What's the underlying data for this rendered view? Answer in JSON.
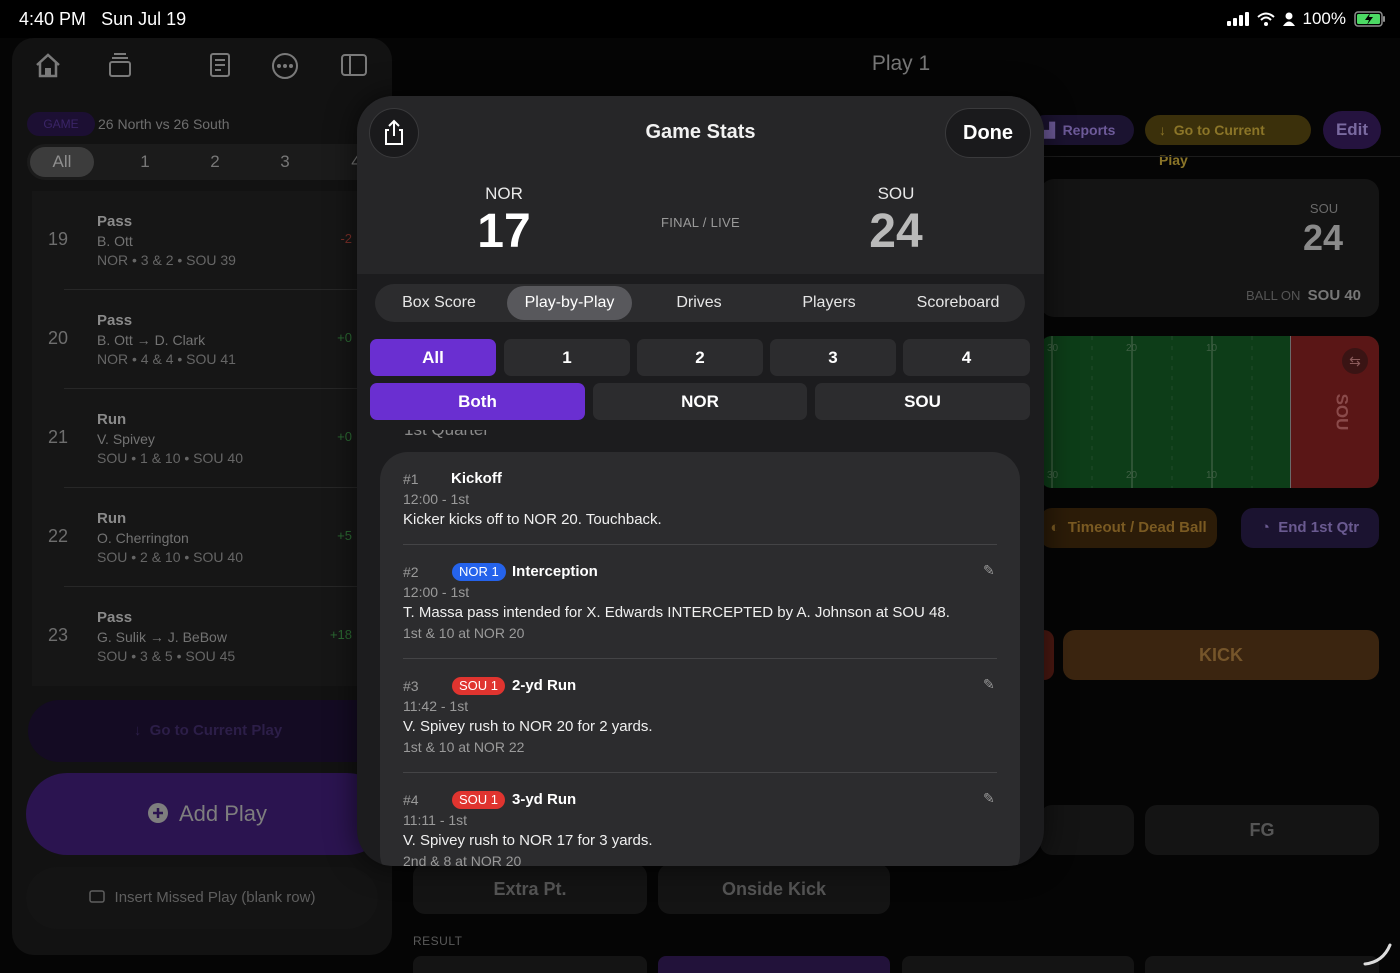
{
  "status_bar": {
    "time": "4:40 PM",
    "date": "Sun Jul 19",
    "battery": "100%"
  },
  "left_panel": {
    "game_badge": "GAME",
    "game_title": "26 North vs 26 South",
    "quarter_filters": [
      "All",
      "1",
      "2",
      "3",
      "4"
    ],
    "plays": [
      {
        "num": "19",
        "type": "Pass",
        "players": "B. Ott",
        "situation": "NOR • 3 & 2 • SOU 39",
        "yards": "-2",
        "yards_color": "#7a2f28"
      },
      {
        "num": "20",
        "type": "Pass",
        "players": "B. Ott → D. Clark",
        "situation": "NOR • 4 & 4 • SOU 41",
        "yards": "+0",
        "yards_color": "#2b6a32"
      },
      {
        "num": "21",
        "type": "Run",
        "players": "V. Spivey",
        "situation": "SOU • 1 & 10 • SOU 40",
        "yards": "+0",
        "yards_color": "#2b6a32"
      },
      {
        "num": "22",
        "type": "Run",
        "players": "O. Cherrington",
        "situation": "SOU • 2 & 10 • SOU 40",
        "yards": "+5",
        "yards_color": "#2b6a32"
      },
      {
        "num": "23",
        "type": "Pass",
        "players": "G. Sulik → J. BeBow",
        "situation": "SOU • 3 & 5 • SOU 45",
        "yards": "+18",
        "yards_color": "#2b6a32"
      }
    ],
    "go_current_play": "Go to Current Play",
    "add_play": "Add Play",
    "insert_missed": "Insert Missed Play (blank row)"
  },
  "right_bg": {
    "title": "Play 1",
    "reports": "Reports",
    "go_current_play": "Go to Current Play",
    "edit": "Edit",
    "team": "SOU",
    "score": "24",
    "ball_on_label": "BALL ON",
    "ball_on_value": "SOU 40",
    "field_end_label": "SOU",
    "yard_top": [
      "30",
      "20",
      "10"
    ],
    "yard_bottom": [
      "30",
      "20",
      "10"
    ],
    "timeout": "Timeout / Dead Ball",
    "end_qtr": "End 1st Qtr",
    "kick": "KICK",
    "fg": "FG",
    "extra_pt": "Extra Pt.",
    "onside_kick": "Onside Kick",
    "result_label": "RESULT"
  },
  "modal": {
    "title": "Game Stats",
    "done": "Done",
    "home_team": "NOR",
    "home_score": "17",
    "away_team": "SOU",
    "away_score": "24",
    "status": "FINAL / LIVE",
    "tabs": [
      "Box Score",
      "Play-by-Play",
      "Drives",
      "Players",
      "Scoreboard"
    ],
    "selected_tab": "Play-by-Play",
    "quarter_filters": [
      "All",
      "1",
      "2",
      "3",
      "4"
    ],
    "team_filters": [
      "Both",
      "NOR",
      "SOU"
    ],
    "section_header": "1st Quarter",
    "entries": [
      {
        "num": "#1",
        "title": "Kickoff",
        "time": "12:00 - 1st",
        "text": "Kicker kicks off to NOR 20. Touchback."
      },
      {
        "num": "#2",
        "badge": "NOR 1",
        "badge_color": "#2563eb",
        "title": "Interception",
        "time": "12:00 - 1st",
        "text": "T. Massa pass intended for X. Edwards INTERCEPTED by A. Johnson at SOU 48.",
        "situation": "1st & 10 at NOR 20"
      },
      {
        "num": "#3",
        "badge": "SOU 1",
        "badge_color": "#e0342f",
        "title": "2-yd Run",
        "time": "11:42 - 1st",
        "text": "V. Spivey rush to NOR 20 for 2 yards.",
        "situation": "1st & 10 at NOR 22"
      },
      {
        "num": "#4",
        "badge": "SOU 1",
        "badge_color": "#e0342f",
        "title": "3-yd Run",
        "time": "11:11 - 1st",
        "text": "V. Spivey rush to NOR 17 for 3 yards.",
        "situation": "2nd & 8 at NOR 20"
      }
    ]
  }
}
